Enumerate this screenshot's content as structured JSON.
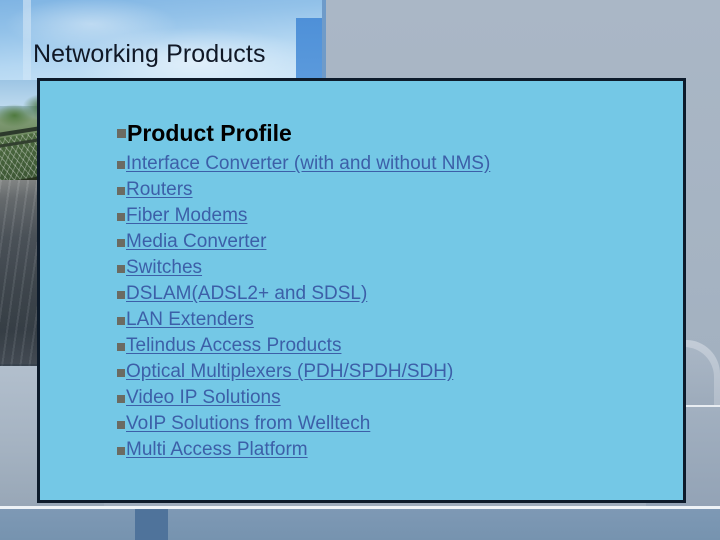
{
  "slide": {
    "title": "Networking Products",
    "heading": {
      "label": "Product Profile",
      "bullet": "square-bullet"
    },
    "items": [
      {
        "label": "Interface Converter (with and without NMS)"
      },
      {
        "label": "Routers"
      },
      {
        "label": "Fiber Modems"
      },
      {
        "label": "Media Converter"
      },
      {
        "label": "Switches"
      },
      {
        "label": "DSLAM(ADSL2+ and SDSL)"
      },
      {
        "label": "LAN Extenders"
      },
      {
        "label": "Telindus Access Products"
      },
      {
        "label": "Optical Multiplexers (PDH/SPDH/SDH)"
      },
      {
        "label": "Video IP Solutions"
      },
      {
        "label": "VoIP Solutions from Welltech"
      },
      {
        "label": "Multi Access Platform"
      }
    ]
  },
  "colors": {
    "content_fill": "#74c8e6",
    "content_border": "#0d1b2b",
    "link_text": "#3c5fa8",
    "heading_text": "#000000",
    "title_text": "#101826",
    "bullet_marker": "#6b6b62",
    "page_background": "#a8b5c4",
    "bottom_bar": "#7e99b5",
    "bottom_tab": "#4f739b",
    "blue_accent": "#4e90d8"
  }
}
